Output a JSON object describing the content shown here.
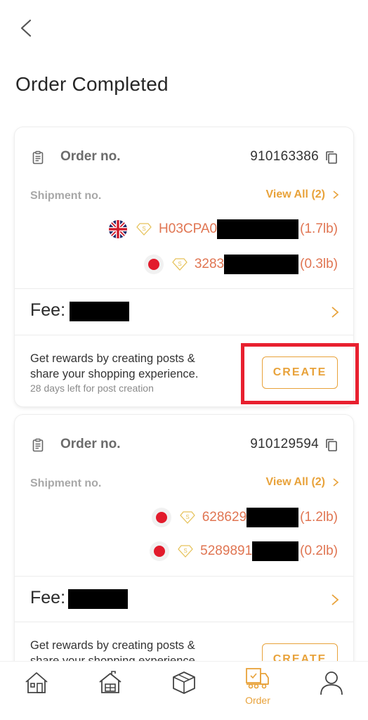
{
  "header": {
    "back_icon": "chevron-left-icon",
    "title": "Order Completed"
  },
  "colors": {
    "accent": "#e8a23a",
    "shipment_text": "#e07552",
    "highlight": "#e8202f",
    "japan_red": "#e21b2c"
  },
  "orders": [
    {
      "order_label": "Order no.",
      "order_number": "910163386",
      "shipment_label": "Shipment no.",
      "view_all_label": "View All (2)",
      "shipments": [
        {
          "flag": "uk-flag-icon",
          "prefix": "H03CPA0",
          "weight": "(1.7lb)"
        },
        {
          "flag": "japan-flag-icon",
          "prefix": "3283",
          "weight": "(0.3lb)"
        }
      ],
      "fee_label": "Fee:",
      "reward_text_line1": "Get rewards by creating posts &",
      "reward_text_line2": "share your shopping experience.",
      "reward_sub": "28 days left for post creation",
      "create_label": "CREATE"
    },
    {
      "order_label": "Order no.",
      "order_number": "910129594",
      "shipment_label": "Shipment no.",
      "view_all_label": "View All (2)",
      "shipments": [
        {
          "flag": "japan-flag-icon",
          "prefix": "628629",
          "weight": "(1.2lb)"
        },
        {
          "flag": "japan-flag-icon",
          "prefix": "5289891",
          "weight": "(0.2lb)"
        }
      ],
      "fee_label": "Fee:",
      "reward_text_line1": "Get rewards by creating posts &",
      "reward_text_line2": "share your shopping experience.",
      "create_label": "CREATE"
    }
  ],
  "tabbar": {
    "tabs": [
      {
        "icon": "home-icon",
        "label": ""
      },
      {
        "icon": "warehouse-icon",
        "label": ""
      },
      {
        "icon": "package-icon",
        "label": ""
      },
      {
        "icon": "delivery-truck-icon",
        "label": "Order",
        "active": true
      },
      {
        "icon": "user-profile-icon",
        "label": ""
      }
    ]
  }
}
